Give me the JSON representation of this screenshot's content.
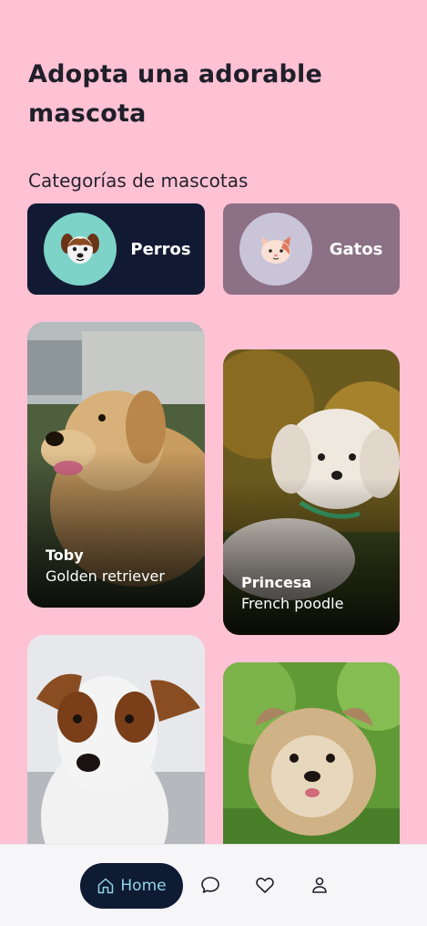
{
  "header": {
    "title": "Adopta una adorable mascota"
  },
  "categories": {
    "label": "Categorías de mascotas",
    "items": [
      {
        "label": "Perros",
        "icon": "dog-face-icon",
        "bg": "#121a33",
        "circle": "#7dd3c8"
      },
      {
        "label": "Gatos",
        "icon": "cat-face-icon",
        "bg": "#8c7085",
        "circle": "#c9c4d8"
      }
    ]
  },
  "pets": [
    {
      "name": "Toby",
      "breed": "Golden retriever"
    },
    {
      "name": "Princesa",
      "breed": "French poodle"
    },
    {
      "name": "",
      "breed": ""
    },
    {
      "name": "",
      "breed": ""
    }
  ],
  "nav": {
    "home_label": "Home",
    "items": [
      "home-icon",
      "chat-icon",
      "heart-icon",
      "profile-icon"
    ]
  },
  "colors": {
    "background": "#ffc2d4",
    "accent_dark": "#0f1b33",
    "accent_light": "#8fd3e8"
  }
}
